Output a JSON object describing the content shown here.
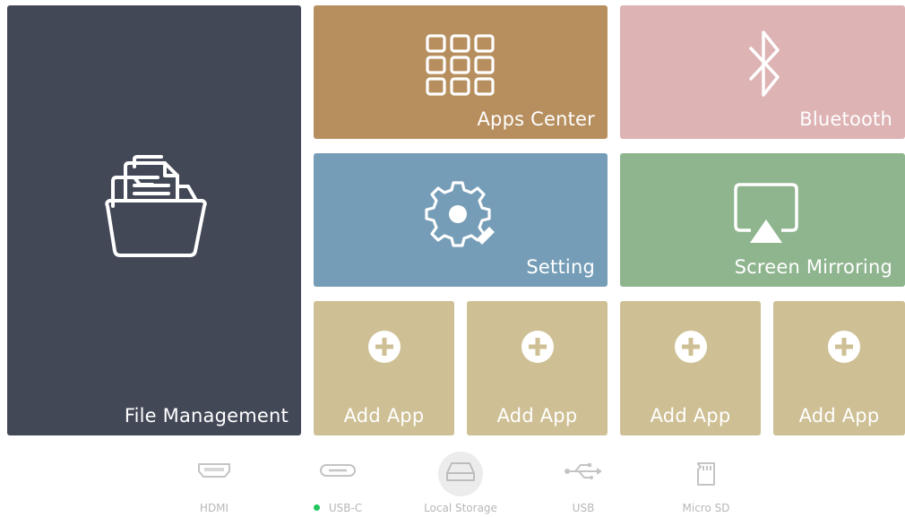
{
  "tiles": {
    "file_management": {
      "label": "File Management",
      "icon": "folder-documents-icon",
      "color": "#434857"
    },
    "apps_center": {
      "label": "Apps Center",
      "icon": "app-grid-icon",
      "color": "#b78f5f"
    },
    "bluetooth": {
      "label": "Bluetooth",
      "icon": "bluetooth-icon",
      "color": "#ddb3b4"
    },
    "setting": {
      "label": "Setting",
      "icon": "gear-icon",
      "color": "#769db7"
    },
    "screen_mirroring": {
      "label": "Screen Mirroring",
      "icon": "airplay-icon",
      "color": "#8fb58f"
    },
    "add_apps": [
      {
        "label": "Add App",
        "icon": "plus-circle-icon"
      },
      {
        "label": "Add App",
        "icon": "plus-circle-icon"
      },
      {
        "label": "Add App",
        "icon": "plus-circle-icon"
      },
      {
        "label": "Add App",
        "icon": "plus-circle-icon"
      }
    ],
    "add_app_color": "#cebf94"
  },
  "dock": {
    "items": [
      {
        "label": "HDMI",
        "icon": "hdmi-port-icon"
      },
      {
        "label": "USB-C",
        "icon": "usb-c-port-icon",
        "status_color": "#22c55e"
      },
      {
        "label": "Local Storage",
        "icon": "hard-drive-icon",
        "selected": true
      },
      {
        "label": "USB",
        "icon": "usb-icon"
      },
      {
        "label": "Micro SD",
        "icon": "sd-card-icon"
      }
    ]
  }
}
